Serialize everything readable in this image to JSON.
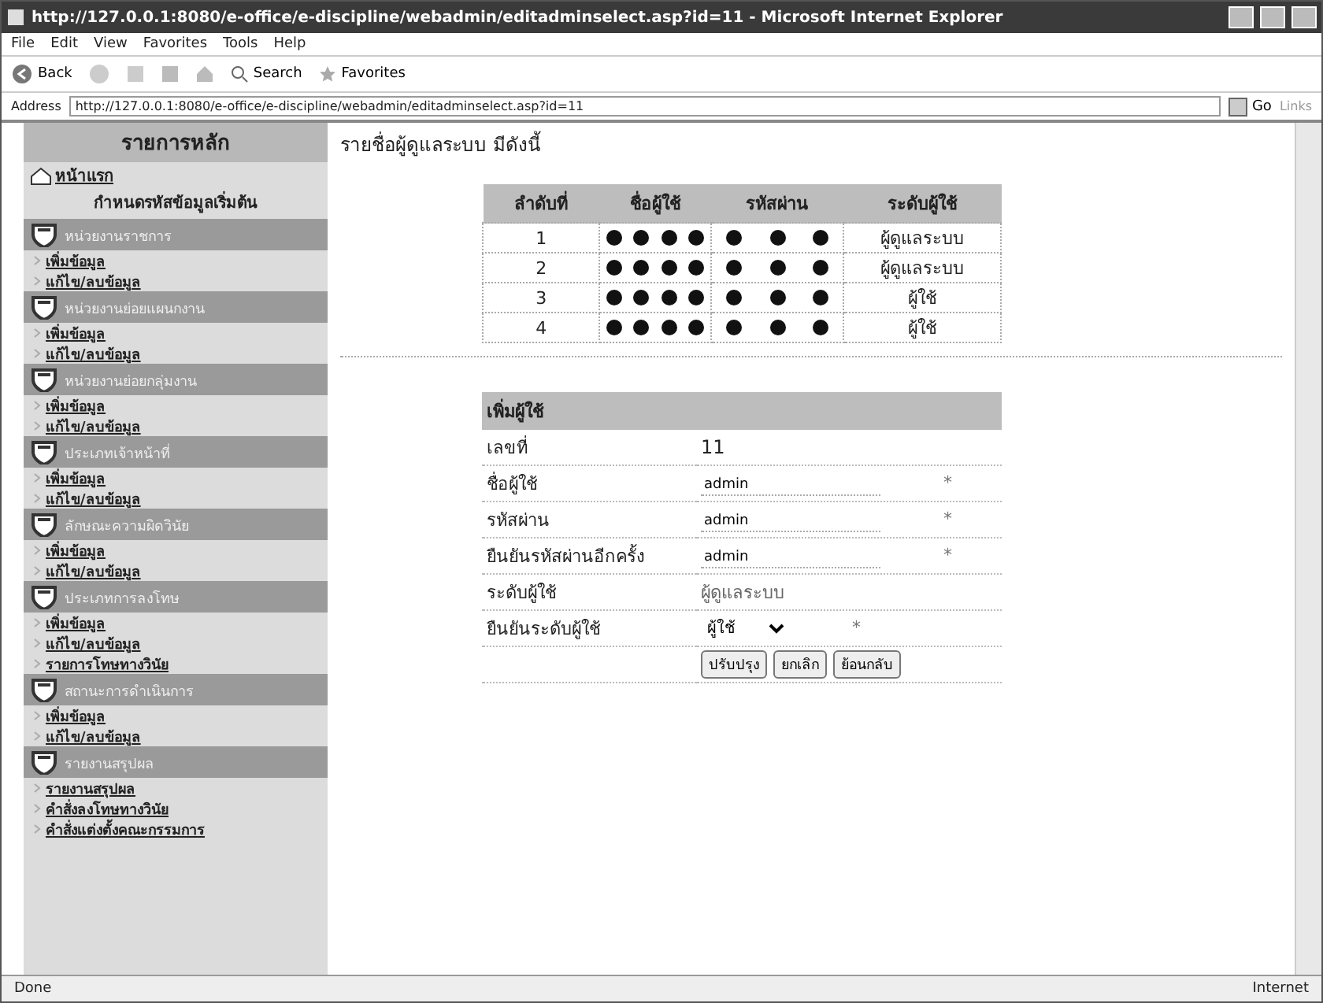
{
  "window": {
    "title": "http://127.0.0.1:8080/e-office/e-discipline/webadmin/editadminselect.asp?id=11 - Microsoft Internet Explorer"
  },
  "menu": [
    "File",
    "Edit",
    "View",
    "Favorites",
    "Tools",
    "Help"
  ],
  "toolbar": {
    "back": "Back",
    "search": "Search",
    "favorites": "Favorites"
  },
  "address_bar": {
    "label": "Address",
    "url": "http://127.0.0.1:8080/e-office/e-discipline/webadmin/editadminselect.asp?id=11",
    "go": "Go",
    "links": "Links"
  },
  "sidebar": {
    "title": "รายการหลัก",
    "home": "หน้าแรก",
    "subtitle": "กำหนดรหัสข้อมูลเริ่มต้น",
    "sections": [
      {
        "title": "หน่วยงานราชการ",
        "items": [
          "เพิ่มข้อมูล",
          "แก้ไข/ลบข้อมูล"
        ]
      },
      {
        "title": "หน่วยงานย่อยแผนกงาน",
        "items": [
          "เพิ่มข้อมูล",
          "แก้ไข/ลบข้อมูล"
        ]
      },
      {
        "title": "หน่วยงานย่อยกลุ่มงาน",
        "items": [
          "เพิ่มข้อมูล",
          "แก้ไข/ลบข้อมูล"
        ]
      },
      {
        "title": "ประเภทเจ้าหน้าที่",
        "items": [
          "เพิ่มข้อมูล",
          "แก้ไข/ลบข้อมูล"
        ]
      },
      {
        "title": "ลักษณะความผิดวินัย",
        "items": [
          "เพิ่มข้อมูล",
          "แก้ไข/ลบข้อมูล"
        ]
      },
      {
        "title": "ประเภทการลงโทษ",
        "items": [
          "เพิ่มข้อมูล",
          "แก้ไข/ลบข้อมูล",
          "รายการโทษทางวินัย"
        ]
      },
      {
        "title": "สถานะการดำเนินการ",
        "items": [
          "เพิ่มข้อมูล",
          "แก้ไข/ลบข้อมูล"
        ]
      },
      {
        "title": "รายงานสรุปผล",
        "items": [
          "รายงานสรุปผล",
          "คำสั่งลงโทษทางวินัย",
          "คำสั่งแต่งตั้งคณะกรรมการ"
        ]
      }
    ]
  },
  "page": {
    "heading": "รายชื่อผู้ดูแลระบบ มีดังนี้"
  },
  "table": {
    "columns": [
      "ลำดับที่",
      "ชื่อผู้ใช้",
      "รหัสผ่าน",
      "ระดับผู้ใช้"
    ],
    "rows": [
      {
        "no": "1",
        "level": "ผู้ดูแลระบบ"
      },
      {
        "no": "2",
        "level": "ผู้ดูแลระบบ"
      },
      {
        "no": "3",
        "level": "ผู้ใช้"
      },
      {
        "no": "4",
        "level": "ผู้ใช้"
      }
    ]
  },
  "form": {
    "title": "เพิ่มผู้ใช้",
    "fields": [
      {
        "kind": "static",
        "label": "เลขที่",
        "value": "11"
      },
      {
        "kind": "input",
        "label": "ชื่อผู้ใช้",
        "value": "admin",
        "required": "*"
      },
      {
        "kind": "input",
        "label": "รหัสผ่าน",
        "value": "admin",
        "required": "*"
      },
      {
        "kind": "input",
        "label": "ยืนยันรหัสผ่านอีกครั้ง",
        "value": "admin",
        "required": "*"
      },
      {
        "kind": "text",
        "label": "ระดับผู้ใช้",
        "value": "ผู้ดูแลระบบ"
      },
      {
        "kind": "select",
        "label": "ยืนยันระดับผู้ใช้",
        "value": "ผู้ใช้",
        "required": "*"
      }
    ],
    "buttons": [
      "ปรับปรุง",
      "ยกเลิก",
      "ย้อนกลับ"
    ]
  },
  "status_bar": {
    "text": "Done",
    "zone": "Internet"
  }
}
